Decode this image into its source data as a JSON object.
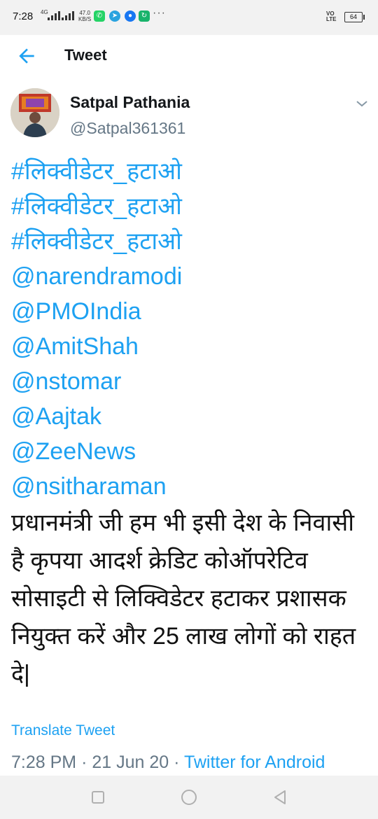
{
  "status_bar": {
    "time": "7:28",
    "network": "4G",
    "speed_value": "47.0",
    "speed_unit": "KB/S",
    "volte_top": "VO",
    "volte_bottom": "LTE",
    "battery": "64",
    "overflow": "···"
  },
  "header": {
    "title": "Tweet",
    "back_icon": "arrow-left-icon"
  },
  "tweet": {
    "author_name": "Satpal Pathania",
    "author_handle": "@Satpal361361",
    "lines": [
      {
        "text": "#लिक्वीडेटर_हटाओ",
        "type": "hashtag"
      },
      {
        "text": "#लिक्वीडेटर_हटाओ",
        "type": "hashtag"
      },
      {
        "text": "#लिक्वीडेटर_हटाओ",
        "type": "hashtag"
      },
      {
        "text": "@narendramodi",
        "type": "mention"
      },
      {
        "text": "@PMOIndia",
        "type": "mention"
      },
      {
        "text": "@AmitShah",
        "type": "mention"
      },
      {
        "text": "@nstomar",
        "type": "mention"
      },
      {
        "text": "@Aajtak",
        "type": "mention"
      },
      {
        "text": "@ZeeNews",
        "type": "mention"
      },
      {
        "text": "@nsitharaman",
        "type": "mention"
      }
    ],
    "message": "प्रधानमंत्री जी हम भी इसी देश के निवासी है कृपया आदर्श क्रेडिट कोऑपरेटिव सोसाइटी से लिक्विडेटर हटाकर प्रशासक नियुक्त करें और 25 लाख लोगों को राहत दे|",
    "translate_label": "Translate Tweet",
    "time": "7:28 PM",
    "separator": "·",
    "date": "21 Jun 20",
    "source": "Twitter for Android"
  },
  "colors": {
    "accent": "#1da1f2",
    "secondary_text": "#657786",
    "primary_text": "#14171a"
  }
}
